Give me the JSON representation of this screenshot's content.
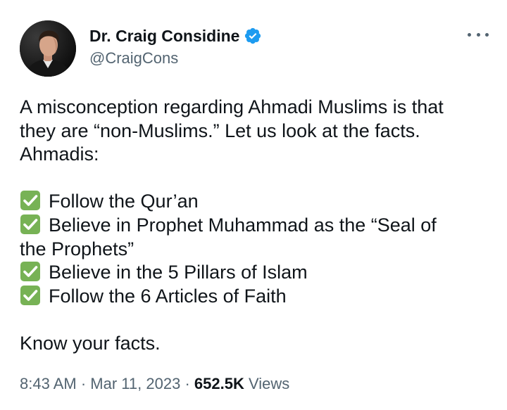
{
  "author": {
    "display_name": "Dr. Craig Considine",
    "handle": "@CraigCons",
    "verified": true,
    "avatar": "profile-photo"
  },
  "tweet": {
    "intro_lines": [
      "A misconception regarding Ahmadi Muslims is that",
      "they are “non-Muslims.” Let us look at the facts.",
      "Ahmadis:"
    ],
    "checklist": [
      "Follow the Qur’an",
      "Believe in Prophet Muhammad as the “Seal of",
      "the Prophets”",
      "Believe in the 5 Pillars of Islam",
      "Follow the 6 Articles of Faith"
    ],
    "closing": "Know your facts.",
    "checklist_icon": "white-check-mark-emoji"
  },
  "meta": {
    "time": "8:43 AM",
    "separator": "·",
    "date": "Mar 11, 2023",
    "views_count": "652.5K",
    "views_label": "Views"
  },
  "icons": {
    "more": "more-horizontal-icon",
    "verified": "verified-badge-icon"
  },
  "colors": {
    "text_primary": "#0f1419",
    "text_secondary": "#536471",
    "verified_blue": "#1d9bf0",
    "check_green": "#77b255"
  }
}
